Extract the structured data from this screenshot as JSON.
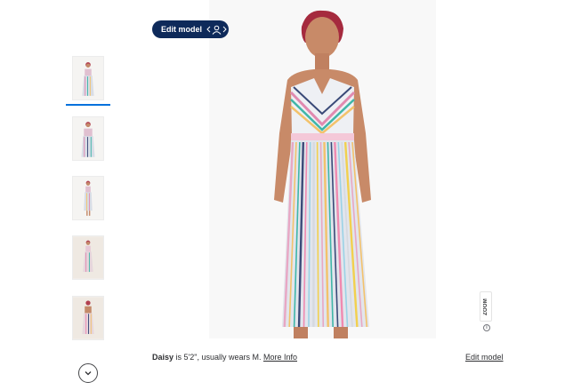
{
  "edit_model_pill": {
    "label": "Edit model",
    "icon": "model-switch-icon",
    "background": "#0e2a5a"
  },
  "thumbnails": [
    {
      "view": "front",
      "selected": true
    },
    {
      "view": "front-close",
      "selected": false
    },
    {
      "view": "full-length",
      "selected": false
    },
    {
      "view": "side",
      "selected": false
    },
    {
      "view": "back",
      "selected": false
    }
  ],
  "accent_color": "#0071dc",
  "more_thumbnails_icon": "chevron-down-icon",
  "zoom_badge": {
    "label": "ZOOM"
  },
  "info_icon": "info-icon",
  "caption": {
    "model_name": "Daisy",
    "model_text": " is 5'2\", usually wears M. ",
    "more_info_link": "More Info"
  },
  "edit_model_link": "Edit model",
  "dress_stripe_colors": [
    "#e8a7c4",
    "#f3c26b",
    "#3fb6a8",
    "#3a4a78",
    "#f08ab0",
    "#9ad2e6",
    "#d6d9e0",
    "#f2d04e"
  ]
}
